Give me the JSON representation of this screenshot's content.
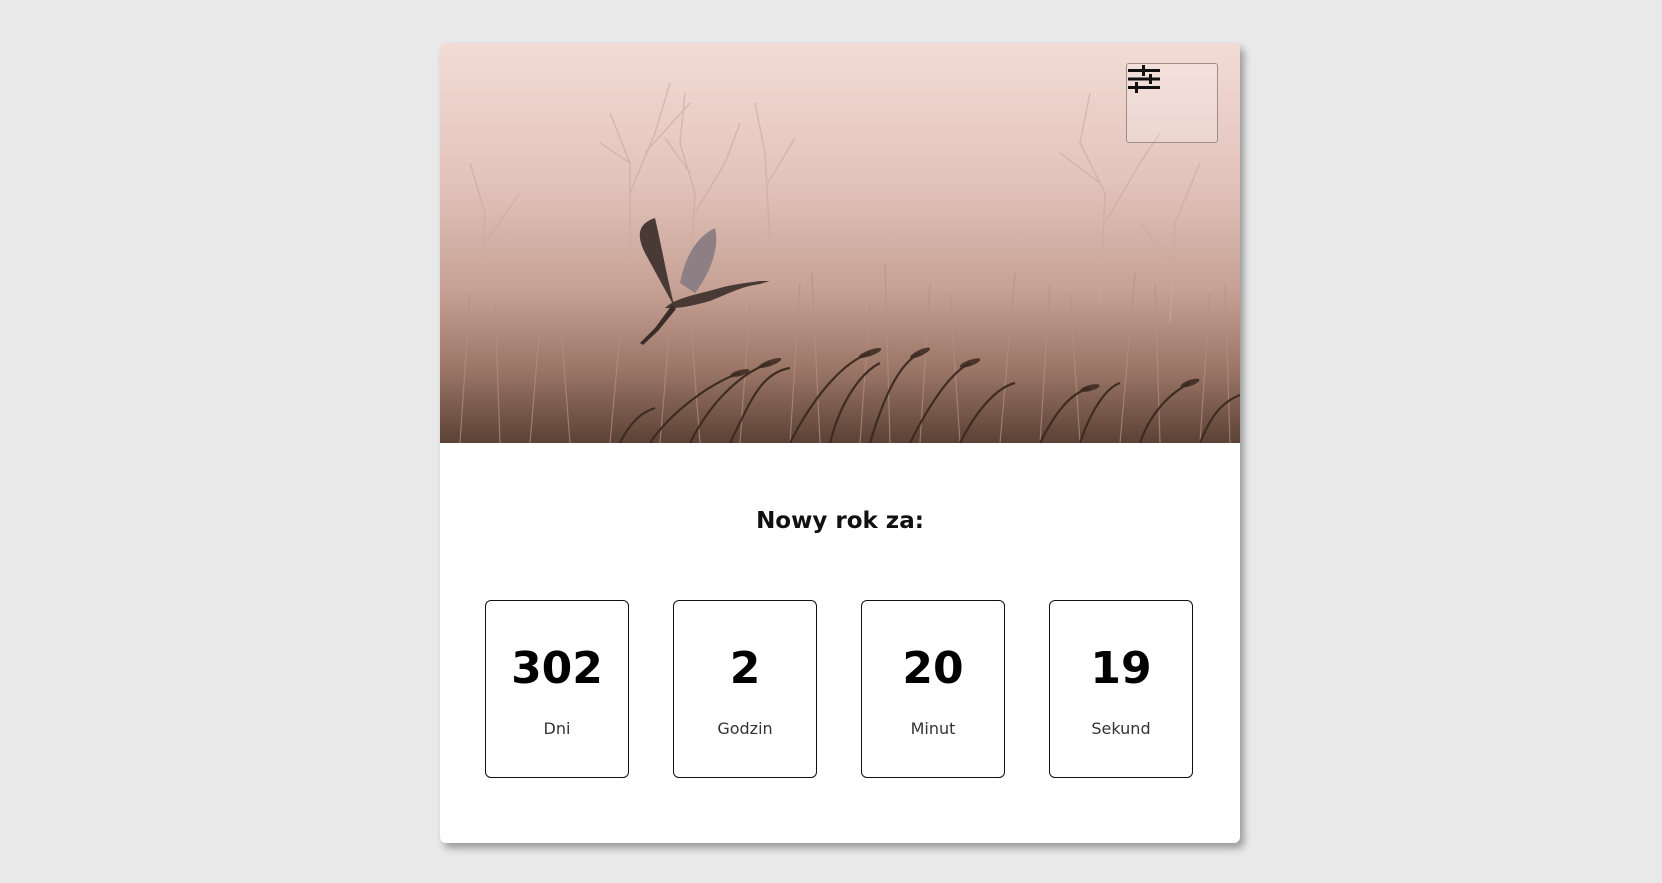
{
  "heading": "Nowy rok za:",
  "settings": {
    "icon": "sliders-icon"
  },
  "countdown": [
    {
      "value": "302",
      "label": "Dni"
    },
    {
      "value": "2",
      "label": "Godzin"
    },
    {
      "value": "20",
      "label": "Minut"
    },
    {
      "value": "19",
      "label": "Sekund"
    }
  ],
  "colors": {
    "background": "#e9e9e9",
    "card": "#ffffff",
    "text": "#000000"
  }
}
